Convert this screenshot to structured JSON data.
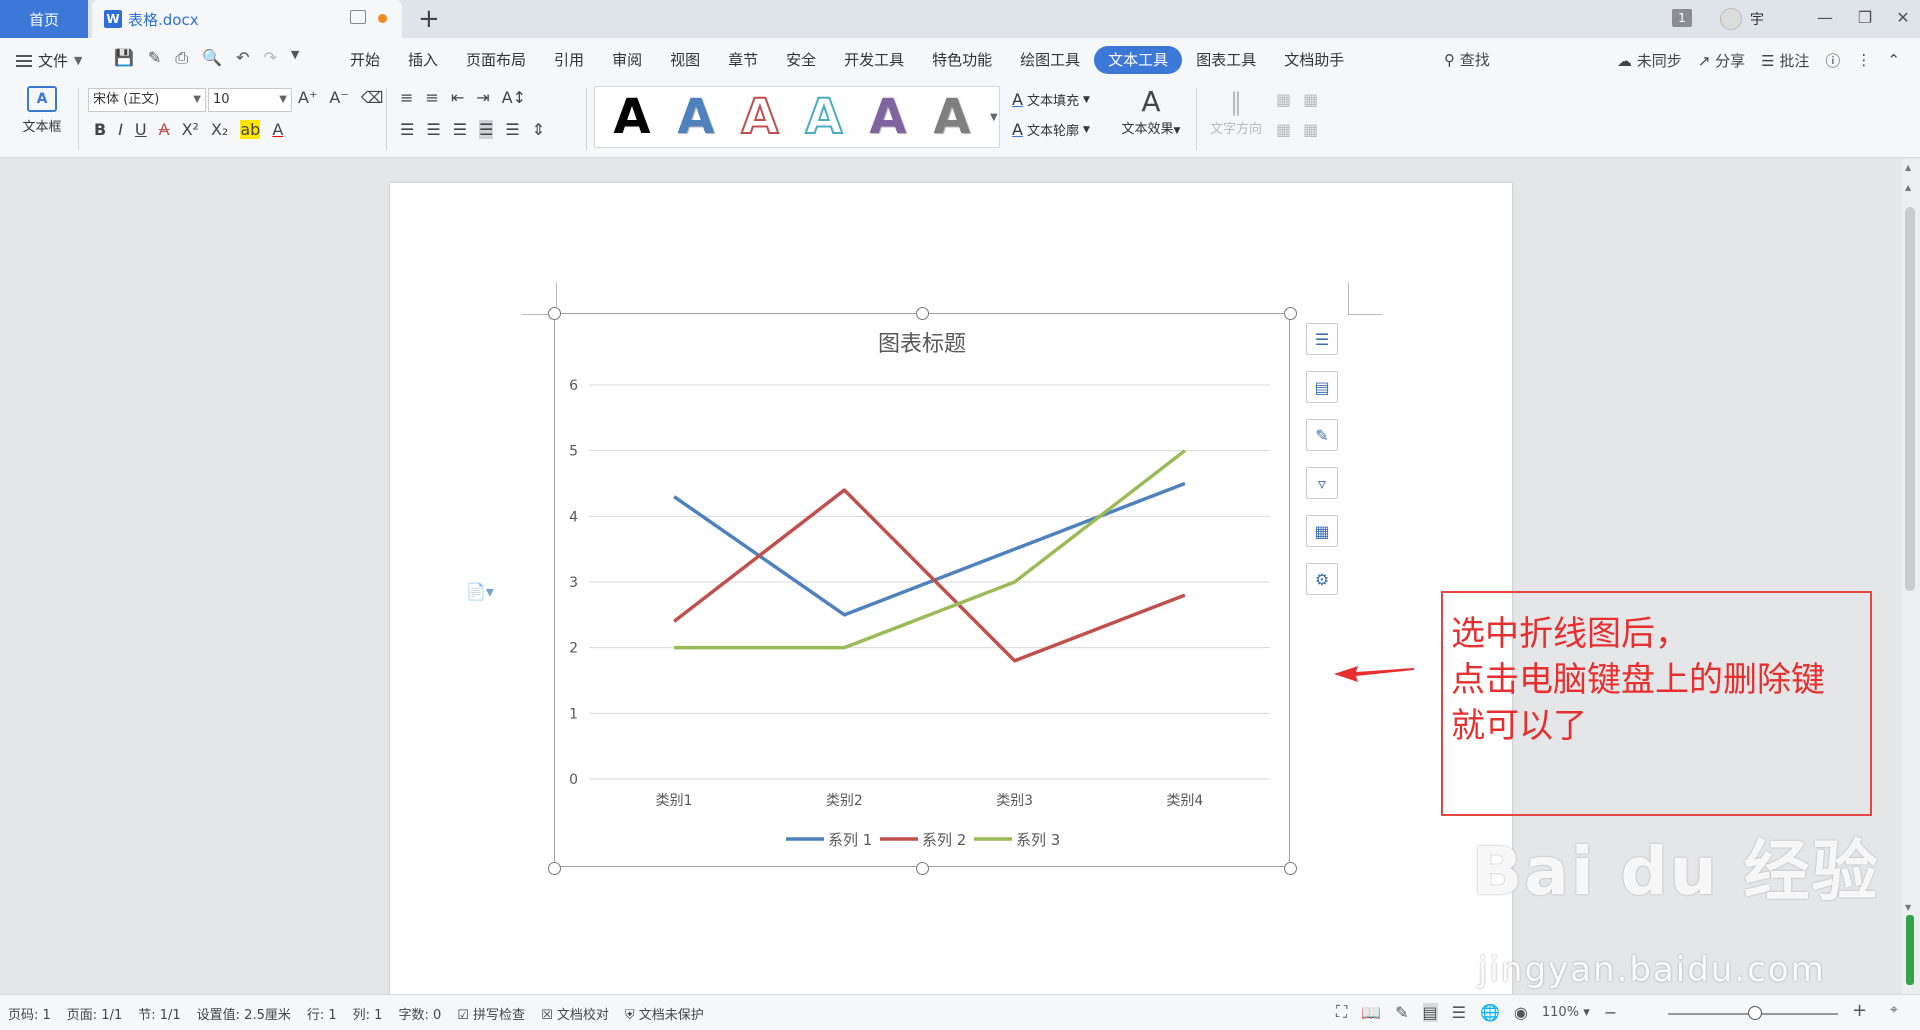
{
  "titlebar": {
    "home_tab": "首页",
    "doc_tab": "表格.docx",
    "add_tab": "+",
    "badge": "1",
    "user_name": "宇"
  },
  "menu": {
    "file": "文件",
    "tabs": [
      {
        "label": "开始",
        "active": false
      },
      {
        "label": "插入",
        "active": false
      },
      {
        "label": "页面布局",
        "active": false
      },
      {
        "label": "引用",
        "active": false
      },
      {
        "label": "审阅",
        "active": false
      },
      {
        "label": "视图",
        "active": false
      },
      {
        "label": "章节",
        "active": false
      },
      {
        "label": "安全",
        "active": false
      },
      {
        "label": "开发工具",
        "active": false
      },
      {
        "label": "特色功能",
        "active": false
      },
      {
        "label": "绘图工具",
        "active": false
      },
      {
        "label": "文本工具",
        "active": true
      },
      {
        "label": "图表工具",
        "active": false
      },
      {
        "label": "文档助手",
        "active": false
      }
    ],
    "search": "查找",
    "sync": "未同步",
    "share": "分享",
    "comment": "批注"
  },
  "ribbon": {
    "textbox_label": "文本框",
    "font_name": "宋体 (正文)",
    "font_size": "10",
    "text_fill": "文本填充",
    "text_outline": "文本轮廓",
    "text_effect": "文本效果",
    "text_direction": "文字方向",
    "style_glyph": "A",
    "style_colors": [
      "#000000",
      "#4f81bd",
      "#c0504d",
      "#4bacc6",
      "#8064a2",
      "#7f7f7f"
    ]
  },
  "chart_data": {
    "type": "line",
    "title": "图表标题",
    "categories": [
      "类别1",
      "类别2",
      "类别3",
      "类别4"
    ],
    "series": [
      {
        "name": "系列 1",
        "color": "#4f81bd",
        "values": [
          4.3,
          2.5,
          3.5,
          4.5
        ]
      },
      {
        "name": "系列 2",
        "color": "#c0504d",
        "values": [
          2.4,
          4.4,
          1.8,
          2.8
        ]
      },
      {
        "name": "系列 3",
        "color": "#9bbb59",
        "values": [
          2.0,
          2.0,
          3.0,
          5.0
        ]
      }
    ],
    "ylim": [
      0,
      6
    ],
    "yticks": [
      "0",
      "1",
      "2",
      "3",
      "4",
      "5",
      "6"
    ],
    "grid": true,
    "legend": "bottom"
  },
  "annotation": {
    "lines": [
      "选中折线图后，",
      "点击电脑键盘上的删除键",
      "就可以了"
    ]
  },
  "watermark": {
    "main": "Bai du 经验",
    "sub": "jingyan.baidu.com"
  },
  "status": {
    "page_num": "页码: 1",
    "pages": "页面: 1/1",
    "section": "节: 1/1",
    "setting": "设置值: 2.5厘米",
    "row": "行: 1",
    "col": "列: 1",
    "words": "字数: 0",
    "spell": "拼写检查",
    "proof": "文档校对",
    "protect": "文档未保护",
    "zoom": "110%"
  }
}
